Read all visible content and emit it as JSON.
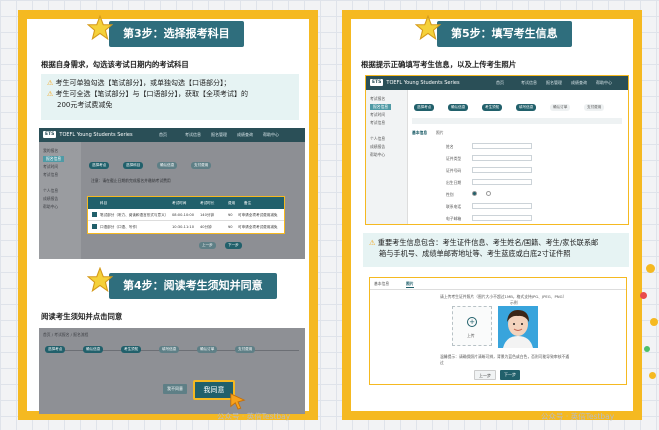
{
  "left": {
    "step3": {
      "title": "第3步：选择报考科目"
    },
    "step3_desc": "根据自身需求，勾选该考试日期内的考试科目",
    "step3_tips": [
      "考生可单独勾选【笔试部分】，或单独勾选【口语部分】；",
      "考生可全选【笔试部分】与【口语部分】，获取【全项考试】的",
      "200元考试费减免"
    ],
    "shot1": {
      "brand": "TOEFL Young Students Series",
      "nav": [
        "首页",
        "考试信息",
        "报名管理",
        "成绩查询",
        "帮助中心"
      ],
      "sidebar": [
        "我的报名",
        "报名信息",
        "考试时间",
        "考试信息",
        "个人信息",
        "成绩报告",
        "帮助中心"
      ],
      "chips": [
        "选择考点",
        "选择科目",
        "确认信息",
        "支付费用"
      ],
      "notice": "注意：请在截止日期前完成报名并缴纳考试费用",
      "table_head": [
        "科目",
        "考试时间",
        "考试时长",
        "费用",
        "备注"
      ],
      "rows": [
        [
          "笔试部分（听力、阅读和语言形式与意义）",
          "08:00-10:00",
          "140分钟",
          "¥0",
          "可申请全项考试费用减免"
        ],
        [
          "口语部分（口语、写作）",
          "10:30-11:10",
          "40分钟",
          "¥0",
          "可申请全项考试费用减免"
        ]
      ],
      "actions": [
        "上一步",
        "下一步"
      ]
    },
    "step4": {
      "title": "第4步：阅读考生须知并同意"
    },
    "step4_desc": "阅读考生须知并点击同意",
    "shot2": {
      "breadcrumb": "首页 / 考试报名 / 报名流程",
      "chips": [
        "选择考点",
        "确认信息",
        "考生须知",
        "填写信息",
        "确认订单",
        "支付费用"
      ],
      "reject": "我不同意",
      "agree": "我同意"
    },
    "watermark": "公众号 · 英倍Testbay"
  },
  "right": {
    "step5": {
      "title": "第5步：填写考生信息"
    },
    "step5_desc": "根据提示正确填写考生信息，以及上传考生照片",
    "shot3": {
      "brand": "TOEFL Young Students Series",
      "nav": [
        "首页",
        "考试信息",
        "报名管理",
        "成绩查询",
        "帮助中心"
      ],
      "sidebar": [
        "考试报名",
        "报名信息",
        "考试时间",
        "考试信息",
        "个人信息",
        "成绩报告",
        "帮助中心"
      ],
      "chips": [
        "选择考点",
        "确认信息",
        "考生须知",
        "填写信息",
        "确认订单",
        "支付费用"
      ],
      "tabs": [
        "基本信息",
        "照片"
      ],
      "fields": [
        "姓名",
        "证件类型",
        "证件号码",
        "出生日期",
        "性别",
        "联系电话",
        "电子邮箱"
      ]
    },
    "step5_tip": [
      "重要考生信息包含：考生证件信息、考生姓名/国籍、考生/家长联系邮",
      "箱与手机号、成绩单邮寄地址等、考生蓝底或白底2寸证件照"
    ],
    "shot4": {
      "tabs": [
        "基本信息",
        "照片"
      ],
      "upload_hint": "请上传考生证件照片（图片大小不超过1MB，格式支持JPG、JPEG、PNG）",
      "upload_label": "上传",
      "sample_label": "示例",
      "note": "温馨提示：请确保照片清晰可辨，背景为蓝色或白色，否则可能导致审核不通过",
      "prev": "上一步",
      "next": "下一步"
    },
    "watermark": "公众号 · 英倍Testbay"
  }
}
